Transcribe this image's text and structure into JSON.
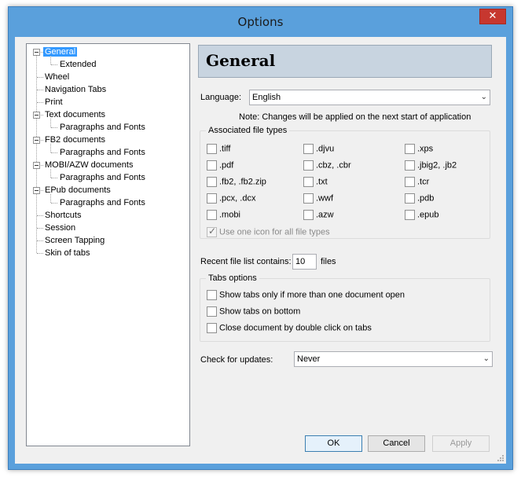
{
  "window": {
    "title": "Options",
    "close_glyph": "✕"
  },
  "tree": {
    "items": [
      {
        "label": "General",
        "level": 0,
        "expandable": true,
        "selected": true
      },
      {
        "label": "Extended",
        "level": 1
      },
      {
        "label": "Wheel",
        "level": 0
      },
      {
        "label": "Navigation Tabs",
        "level": 0
      },
      {
        "label": "Print",
        "level": 0
      },
      {
        "label": "Text documents",
        "level": 0,
        "expandable": true
      },
      {
        "label": "Paragraphs and Fonts",
        "level": 1
      },
      {
        "label": "FB2 documents",
        "level": 0,
        "expandable": true
      },
      {
        "label": "Paragraphs and Fonts",
        "level": 1
      },
      {
        "label": "MOBI/AZW documents",
        "level": 0,
        "expandable": true
      },
      {
        "label": "Paragraphs and Fonts",
        "level": 1
      },
      {
        "label": "EPub documents",
        "level": 0,
        "expandable": true
      },
      {
        "label": "Paragraphs and Fonts",
        "level": 1
      },
      {
        "label": "Shortcuts",
        "level": 0
      },
      {
        "label": "Session",
        "level": 0
      },
      {
        "label": "Screen Tapping",
        "level": 0
      },
      {
        "label": "Skin of tabs",
        "level": 0
      }
    ]
  },
  "panel": {
    "title": "General",
    "language_label": "Language:",
    "language_value": "English",
    "note": "Note: Changes will be applied on the next start of application",
    "assoc": {
      "title": "Associated file types",
      "items": [
        {
          "label": ".tiff",
          "checked": false
        },
        {
          "label": ".djvu",
          "checked": false
        },
        {
          "label": ".xps",
          "checked": false
        },
        {
          "label": ".pdf",
          "checked": false
        },
        {
          "label": ".cbz, .cbr",
          "checked": false
        },
        {
          "label": ".jbig2, .jb2",
          "checked": false
        },
        {
          "label": ".fb2, .fb2.zip",
          "checked": false
        },
        {
          "label": ".txt",
          "checked": false
        },
        {
          "label": ".tcr",
          "checked": false
        },
        {
          "label": ".pcx, .dcx",
          "checked": false
        },
        {
          "label": ".wwf",
          "checked": false
        },
        {
          "label": ".pdb",
          "checked": false
        },
        {
          "label": ".mobi",
          "checked": false
        },
        {
          "label": ".azw",
          "checked": false
        },
        {
          "label": ".epub",
          "checked": false
        }
      ],
      "one_icon_label": "Use one icon for all file types",
      "one_icon_checked": true
    },
    "recent_label": "Recent file list contains:",
    "recent_value": "10",
    "recent_suffix": "files",
    "tabs": {
      "title": "Tabs options",
      "items": [
        {
          "label": "Show tabs only if more than one document open",
          "checked": false
        },
        {
          "label": "Show tabs on bottom",
          "checked": false
        },
        {
          "label": "Close document by double click on tabs",
          "checked": false
        }
      ]
    },
    "updates_label": "Check for updates:",
    "updates_value": "Never"
  },
  "buttons": {
    "ok": "OK",
    "cancel": "Cancel",
    "apply": "Apply"
  },
  "icons": {
    "dropdown": "chevron-down-icon",
    "close": "close-icon",
    "expander": "tree-collapse-icon"
  },
  "colors": {
    "selection": "#3399ff",
    "frame": "#5aa0dc",
    "close": "#c7372f",
    "header": "#c8d4e0"
  }
}
